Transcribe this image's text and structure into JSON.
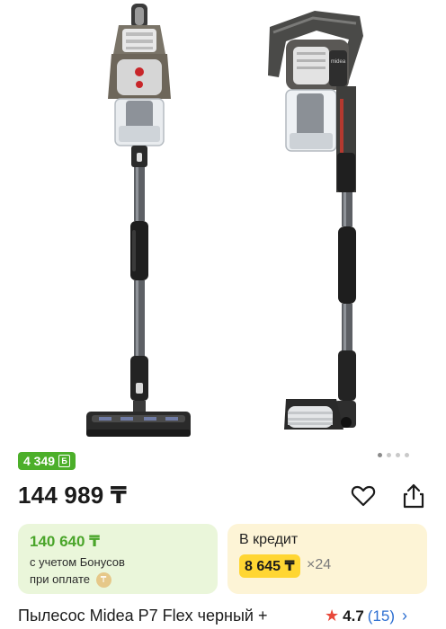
{
  "gallery": {
    "images": [
      "vacuum-front-view",
      "vacuum-side-view"
    ],
    "dots_count": 4,
    "active_dot": 0
  },
  "bonus_badge": {
    "text": "4 349",
    "icon": "bonus-b-icon"
  },
  "price": {
    "main": "144 989 ₸"
  },
  "actions": {
    "favorite_icon": "heart-icon",
    "share_icon": "share-icon"
  },
  "bonus_card": {
    "price": "140 640 ₸",
    "note_line1": "с учетом Бонусов",
    "note_line2": "при оплате",
    "coin_icon": "kaspi-coin-icon"
  },
  "credit_card": {
    "title": "В кредит",
    "amount": "8 645 ₸",
    "term": "×24"
  },
  "product": {
    "title": "Пылесос Midea P7 Flex черный +",
    "rating": "4.7",
    "reviews": "(15)"
  },
  "colors": {
    "bonus_green": "#4caf2a",
    "credit_yellow": "#ffd633",
    "link_blue": "#2d6fd1",
    "star_red": "#e8483a"
  }
}
